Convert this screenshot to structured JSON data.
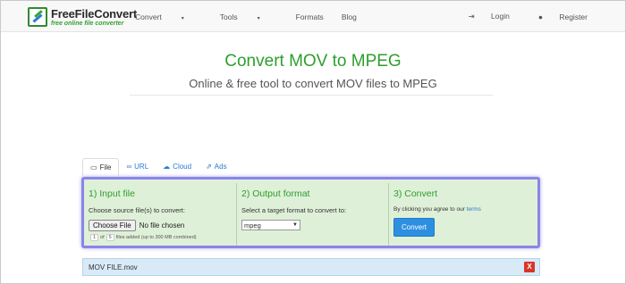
{
  "brand": {
    "name": "FreeFileConvert",
    "tagline": "free online file converter"
  },
  "nav": {
    "items": [
      {
        "label": "Convert",
        "caret": "▾"
      },
      {
        "label": "Tools",
        "caret": "▾"
      },
      {
        "label": "Formats"
      },
      {
        "label": "Blog"
      }
    ],
    "login": "Login",
    "register": "Register"
  },
  "hero": {
    "title": "Convert MOV to MPEG",
    "subtitle": "Online & free tool to convert MOV files to MPEG"
  },
  "tabs": [
    {
      "label": "File",
      "icon": "monitor-icon"
    },
    {
      "label": "URL",
      "icon": "link-icon"
    },
    {
      "label": "Cloud",
      "icon": "cloud-icon"
    },
    {
      "label": "Ads",
      "icon": "external-link-icon"
    }
  ],
  "input": {
    "heading": "1) Input file",
    "label": "Choose source file(s) to convert:",
    "button": "Choose File",
    "status": "No file chosen",
    "count_current": "1",
    "of": "of",
    "count_max": "5",
    "files_added": "files added (up to 300 MB combined)"
  },
  "output": {
    "heading": "2) Output format",
    "label": "Select a target format to convert to:",
    "selected": "mpeg"
  },
  "convert": {
    "heading": "3) Convert",
    "terms_prefix": "By clicking you agree to our",
    "terms_link": "terms",
    "button": "Convert"
  },
  "filebar": {
    "name": "MOV FILE.mov",
    "remove": "X"
  },
  "colors": {
    "accent_green": "#2e9e2e",
    "panel_bg": "#dff0d8",
    "highlight": "#8a86e6",
    "button_blue": "#2d8fe0"
  }
}
